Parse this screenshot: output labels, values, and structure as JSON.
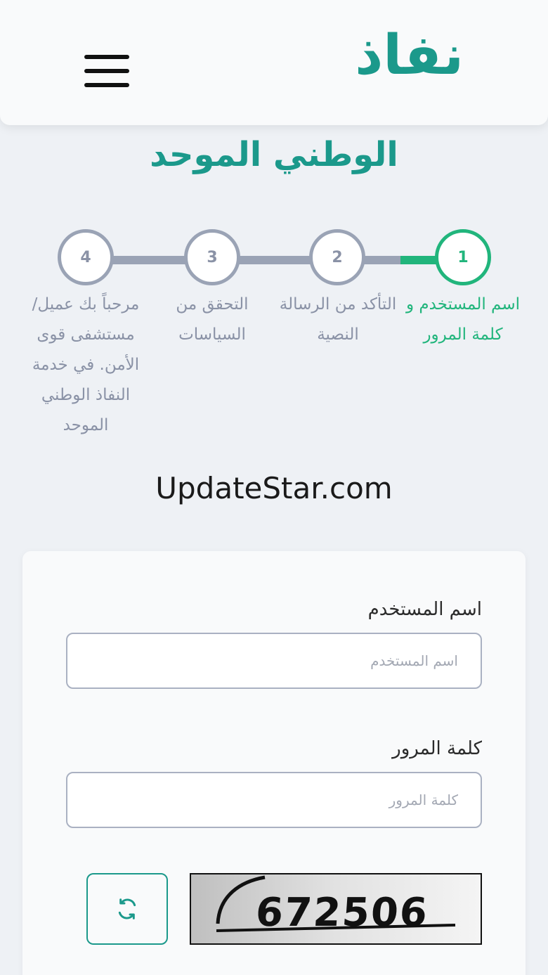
{
  "header": {
    "logo": "نفاذ",
    "menu_icon": "hamburger-menu-icon"
  },
  "subtitle": "الوطني الموحد",
  "stepper": {
    "active_step": 1,
    "steps": [
      {
        "number": "1",
        "label": "اسم المستخدم و كلمة المرور",
        "state": "active"
      },
      {
        "number": "2",
        "label": "التأكد من الرسالة النصية",
        "state": "inactive"
      },
      {
        "number": "3",
        "label": "التحقق من السياسات",
        "state": "inactive"
      },
      {
        "number": "4",
        "label": "مرحباً بك عميل/ مستشفى قوى الأمن. في خدمة النفاذ الوطني الموحد",
        "state": "inactive"
      }
    ],
    "colors": {
      "active": "#21b57c",
      "inactive": "#9aa3b5"
    }
  },
  "watermark": "UpdateStar.com",
  "form": {
    "username": {
      "label": "اسم المستخدم",
      "placeholder": "اسم المستخدم",
      "value": ""
    },
    "password": {
      "label": "كلمة المرور",
      "placeholder": "كلمة المرور",
      "value": ""
    },
    "captcha": {
      "text": "672506",
      "refresh_icon": "refresh-icon"
    }
  },
  "colors": {
    "brand": "#1b998b",
    "background": "#eef1f5"
  }
}
